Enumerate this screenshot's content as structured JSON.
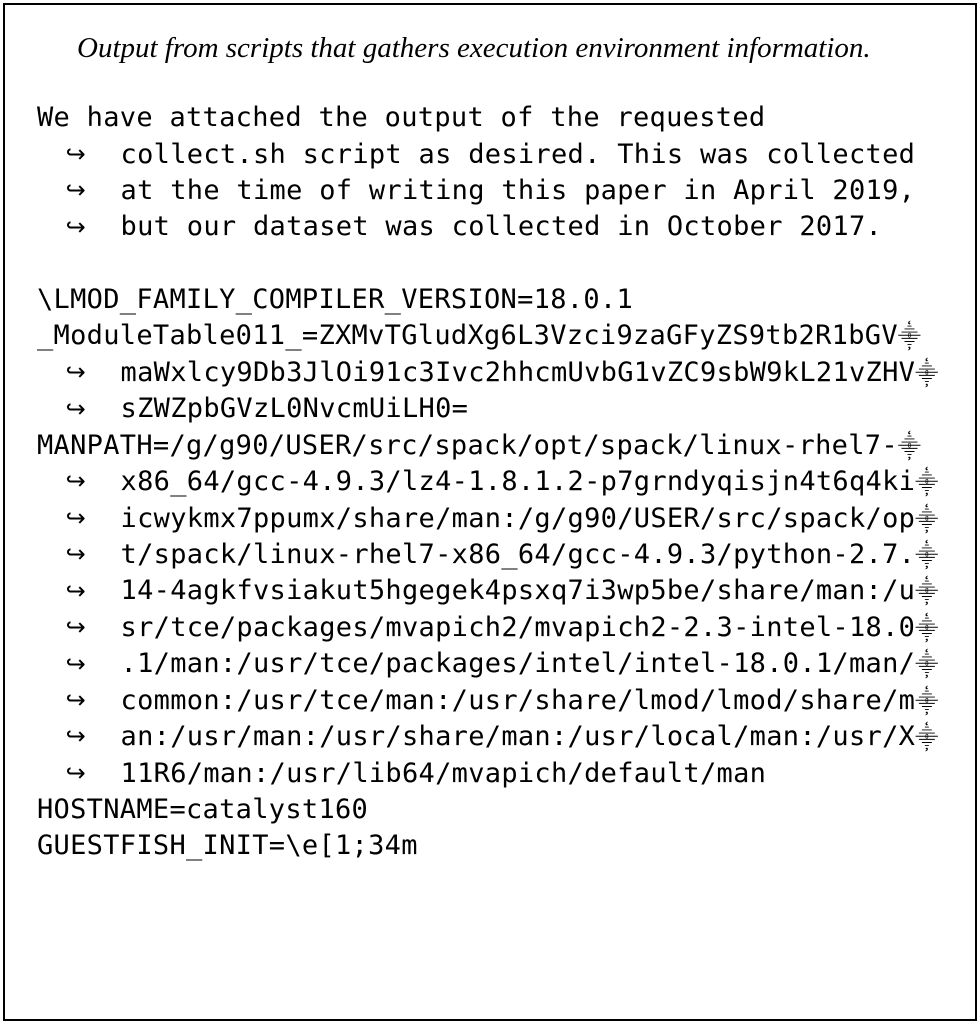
{
  "caption": "Output from scripts that gathers execution environment information.",
  "intro_lines": [
    "We have attached the output of the requested",
    "collect.sh script as desired. This was collected",
    "at the time of writing this paper in April 2019,",
    "but our dataset was collected in October 2017."
  ],
  "env_lines": [
    "\\LMOD_FAMILY_COMPILER_VERSION=18.0.1",
    "_ModuleTable011_=ZXMvTGludXg6L3Vzci9zaGFyZS9tb2R1bGV",
    "maWxlcy9Db3JlOi91c3Ivc2hhcmUvbG1vZC9sbW9kL21vZHV",
    "sZWZpbGVzL0NvcmUiLH0=",
    "MANPATH=/g/g90/USER/src/spack/opt/spack/linux-rhel7-",
    "x86_64/gcc-4.9.3/lz4-1.8.1.2-p7grndyqisjn4t6q4ki",
    "icwykmx7ppumx/share/man:/g/g90/USER/src/spack/op",
    "t/spack/linux-rhel7-x86_64/gcc-4.9.3/python-2.7.",
    "14-4agkfvsiakut5hgegek4psxq7i3wp5be/share/man:/u",
    "sr/tce/packages/mvapich2/mvapich2-2.3-intel-18.0",
    ".1/man:/usr/tce/packages/intel/intel-18.0.1/man/",
    "common:/usr/tce/man:/usr/share/lmod/lmod/share/m",
    "an:/usr/man:/usr/share/man:/usr/local/man:/usr/X",
    "11R6/man:/usr/lib64/mvapich/default/man",
    "HOSTNAME=catalyst160",
    "GUESTFISH_INIT=\\e[1;34m"
  ],
  "line_meta": [
    {
      "hook": false,
      "ret": false
    },
    {
      "hook": false,
      "ret": true
    },
    {
      "hook": true,
      "ret": true
    },
    {
      "hook": true,
      "ret": false
    },
    {
      "hook": false,
      "ret": true
    },
    {
      "hook": true,
      "ret": true
    },
    {
      "hook": true,
      "ret": true
    },
    {
      "hook": true,
      "ret": true
    },
    {
      "hook": true,
      "ret": true
    },
    {
      "hook": true,
      "ret": true
    },
    {
      "hook": true,
      "ret": true
    },
    {
      "hook": true,
      "ret": true
    },
    {
      "hook": true,
      "ret": true
    },
    {
      "hook": true,
      "ret": false
    },
    {
      "hook": false,
      "ret": false
    },
    {
      "hook": false,
      "ret": false
    }
  ],
  "intro_meta": [
    {
      "hook": false,
      "ret": false
    },
    {
      "hook": true,
      "ret": false
    },
    {
      "hook": true,
      "ret": false
    },
    {
      "hook": true,
      "ret": false
    }
  ],
  "symbols": {
    "hookarrow": "↪",
    "retmark": "⸎"
  }
}
